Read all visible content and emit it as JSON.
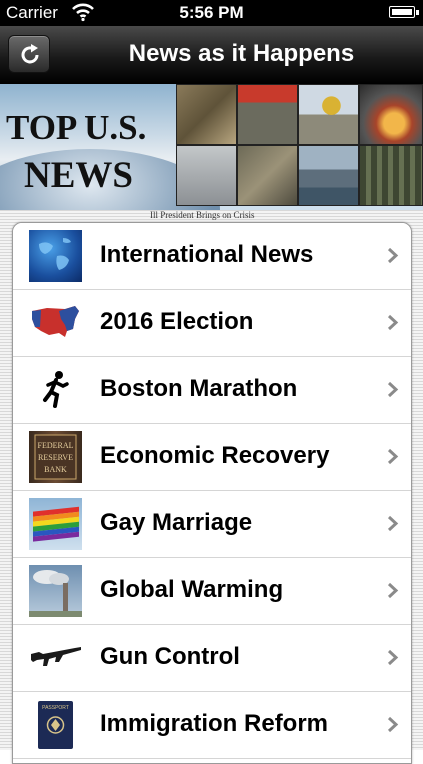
{
  "status_bar": {
    "carrier": "Carrier",
    "time": "5:56 PM"
  },
  "nav_bar": {
    "title": "News as it Happens"
  },
  "banner": {
    "title_line1": "TOP U.S.",
    "title_line2": "NEWS"
  },
  "newspaper_header": "Ill President Brings on Crisis",
  "topics": [
    {
      "label": "International News",
      "icon": "globe-icon"
    },
    {
      "label": "2016 Election",
      "icon": "us-map-icon"
    },
    {
      "label": "Boston Marathon",
      "icon": "runner-icon"
    },
    {
      "label": "Economic Recovery",
      "icon": "federal-reserve-sign-icon",
      "icon_text": [
        "FEDERAL",
        "RESERVE",
        "BANK"
      ]
    },
    {
      "label": "Gay Marriage",
      "icon": "rainbow-flag-icon"
    },
    {
      "label": "Global Warming",
      "icon": "smokestack-icon"
    },
    {
      "label": "Gun Control",
      "icon": "rifle-icon"
    },
    {
      "label": "Immigration Reform",
      "icon": "passport-icon",
      "icon_text": "PASSPORT"
    }
  ],
  "colors": {
    "nav_bar": "#1a1a1a",
    "status_bar": "#000000",
    "chevron": "#8a8a8a",
    "list_bg": "#ffffff"
  }
}
